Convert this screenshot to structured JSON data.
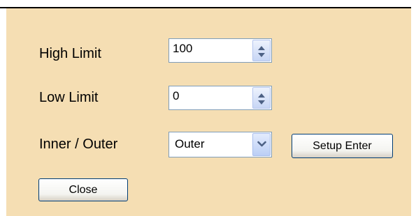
{
  "labels": {
    "high_limit": "High Limit",
    "low_limit": "Low Limit",
    "inner_outer": "Inner / Outer"
  },
  "inputs": {
    "high_limit_value": "100",
    "low_limit_value": "0",
    "inner_outer_selected": "Outer"
  },
  "buttons": {
    "setup_enter": "Setup Enter",
    "close": "Close"
  },
  "icons": {
    "spinner": "spin-up-down-icon",
    "dropdown": "chevron-down-icon"
  },
  "colors": {
    "panel_background": "#f5deb3",
    "field_border": "#7f9db9",
    "button_border": "#003c74"
  }
}
